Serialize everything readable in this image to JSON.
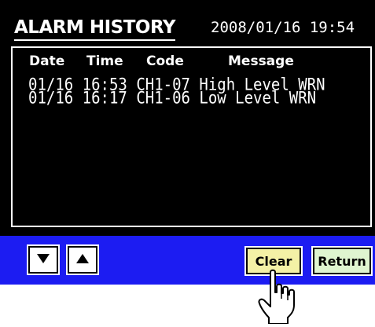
{
  "header": {
    "title": "ALARM HISTORY",
    "datetime": "2008/01/16  19:54"
  },
  "table": {
    "columns": [
      "Date",
      "Time",
      "Code",
      "Message"
    ],
    "rows": [
      {
        "date": "01/16",
        "time": "16:53",
        "code": "CH1-07",
        "message": "High Level WRN"
      },
      {
        "date": "01/16",
        "time": "16:17",
        "code": "CH1-06",
        "message": "Low Level WRN"
      }
    ]
  },
  "controls": {
    "scroll_down_icon": "triangle-down-icon",
    "scroll_up_icon": "triangle-up-icon",
    "clear_label": "Clear",
    "return_label": "Return",
    "pointer_icon": "pointing-hand-icon"
  },
  "colors": {
    "screen_background": "#000000",
    "text": "#ffffff",
    "button_bar": "#1c1cf2",
    "clear_button": "#f4f1a6",
    "return_button": "#dff5d0"
  }
}
